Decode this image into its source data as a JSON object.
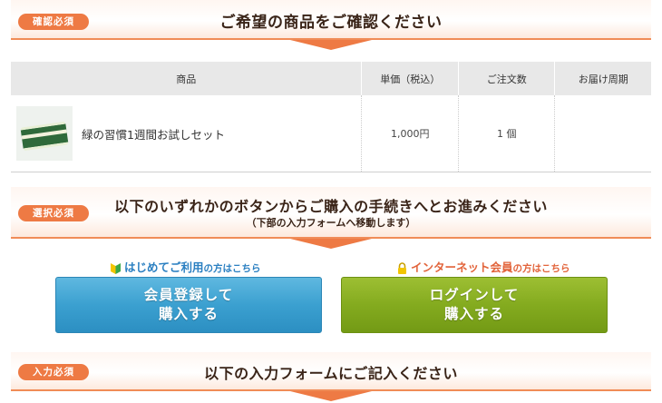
{
  "section1": {
    "badge": "確認必須",
    "title": "ご希望の商品をご確認ください"
  },
  "table": {
    "headers": [
      "商品",
      "単価（税込）",
      "ご注文数",
      "お届け周期"
    ],
    "rows": [
      {
        "name": "緑の習慣1週間お試しセット",
        "price": "1,000円",
        "qty": "1 個",
        "cycle": ""
      }
    ]
  },
  "section2": {
    "badge": "選択必須",
    "title": "以下のいずれかのボタンからご購入の手続きへとお進みください",
    "subtitle": "（下部の入力フォームへ移動します）"
  },
  "choices": {
    "new_label": "はじめてご利用",
    "new_suffix": "の方はこちら",
    "member_label": "インターネット会員",
    "member_suffix": "の方はこちら",
    "register_button_line1": "会員登録して",
    "register_button_line2": "購入する",
    "login_button_line1": "ログインして",
    "login_button_line2": "購入する"
  },
  "section3": {
    "badge": "入力必須",
    "title": "以下の入力フォームにご記入ください"
  },
  "colors": {
    "accent": "#ee7a44",
    "blue_button": "#3ba0d0",
    "green_button": "#84ab1f",
    "new_label": "#2a7fc1",
    "member_label": "#e2633a"
  },
  "icons": {
    "new": "beginner-mark-icon",
    "member": "lock-icon"
  }
}
